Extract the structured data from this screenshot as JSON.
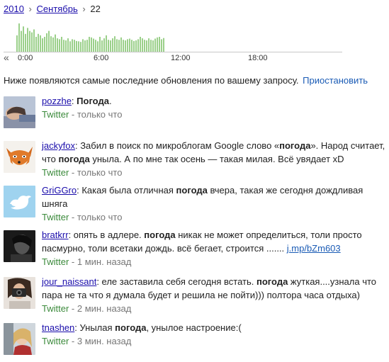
{
  "breadcrumb": {
    "year": "2010",
    "month": "Сентябрь",
    "day": "22",
    "separator": "›"
  },
  "timeline": {
    "prev_arrow": "«",
    "ticks": [
      "0:00",
      "6:00",
      "12:00",
      "18:00"
    ],
    "bar_color": "#9bd08a",
    "baseline_color": "#c8c8c8",
    "activity": [
      0.55,
      0.95,
      0.7,
      0.85,
      0.6,
      0.8,
      0.7,
      0.65,
      0.75,
      0.5,
      0.6,
      0.55,
      0.45,
      0.5,
      0.62,
      0.7,
      0.52,
      0.48,
      0.58,
      0.45,
      0.42,
      0.5,
      0.4,
      0.38,
      0.45,
      0.35,
      0.42,
      0.4,
      0.36,
      0.35,
      0.33,
      0.42,
      0.38,
      0.4,
      0.5,
      0.48,
      0.44,
      0.4,
      0.35,
      0.5,
      0.38,
      0.45,
      0.55,
      0.4,
      0.38,
      0.45,
      0.52,
      0.42,
      0.4,
      0.48,
      0.4,
      0.38,
      0.42,
      0.44,
      0.4,
      0.36,
      0.38,
      0.42,
      0.5,
      0.45,
      0.4,
      0.38,
      0.45,
      0.4,
      0.38,
      0.44,
      0.48,
      0.5,
      0.42,
      0.46
    ]
  },
  "status": {
    "text": "Ниже появляются самые последние обновления по вашему запросу.",
    "pause_label": "Приостановить"
  },
  "posts": [
    {
      "user": "pozzhe",
      "segments": [
        [
          "",
          ": "
        ],
        [
          "kw",
          "Погода"
        ],
        [
          "",
          "."
        ]
      ],
      "source": "Twitter",
      "time": "только что",
      "avatar": "sleeping-person"
    },
    {
      "user": "jackyfox",
      "segments": [
        [
          "",
          ": Забил в поиск по микроблогам Google слово «"
        ],
        [
          "kw",
          "погода"
        ],
        [
          "",
          "». Народ считает, что "
        ],
        [
          "kw",
          "погода"
        ],
        [
          "",
          " уныла. А по мне так осень — такая милая. Всё увядает xD"
        ]
      ],
      "source": "Twitter",
      "time": "только что",
      "avatar": "fox"
    },
    {
      "user": "GriGGro",
      "segments": [
        [
          "",
          ": Какая была отличная "
        ],
        [
          "kw",
          "погода"
        ],
        [
          "",
          " вчера, такая же сегодня дождливая шняга"
        ]
      ],
      "source": "Twitter",
      "time": "только что",
      "avatar": "twitter-bird"
    },
    {
      "user": "bratkrr",
      "segments": [
        [
          "",
          ": опять в адлере. "
        ],
        [
          "kw",
          "погода"
        ],
        [
          "",
          " никак не может определиться, толи просто пасмурно, толи всетаки дождь. всё бегает, строится ....... "
        ],
        [
          "url",
          "j.mp/bZm603"
        ]
      ],
      "source": "Twitter",
      "time": "1 мин. назад",
      "avatar": "dark-portrait"
    },
    {
      "user": "jour_naissant",
      "segments": [
        [
          "",
          ": еле заставила себя сегодня встать. "
        ],
        [
          "kw",
          "погода"
        ],
        [
          "",
          " жуткая....узнала что пара не та что я думала будет и решила не пойти))) полтора часа отдыха)"
        ]
      ],
      "source": "Twitter",
      "time": "2 мин. назад",
      "avatar": "camera-girl"
    },
    {
      "user": "tnashen",
      "segments": [
        [
          "",
          ": Унылая "
        ],
        [
          "kw",
          "погода"
        ],
        [
          "",
          ", унылое настроение:("
        ]
      ],
      "source": "Twitter",
      "time": "3 мин. назад",
      "avatar": "car-girl"
    }
  ]
}
